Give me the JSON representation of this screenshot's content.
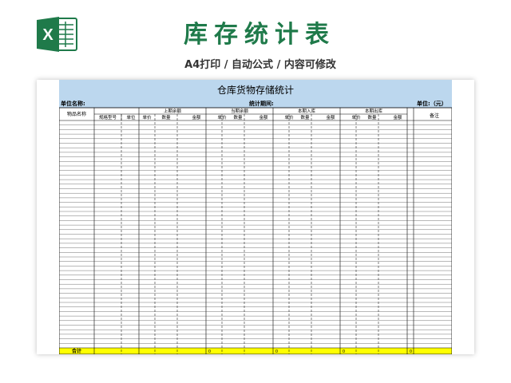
{
  "header": {
    "logo_letter": "X",
    "title": "库存统计表",
    "subtitle": "A4打印 / 自动公式 / 内容可修改"
  },
  "sheet": {
    "title": "仓库货物存储统计",
    "unit_name_label": "单位名称:",
    "period_label": "统计期间:",
    "unit_label": "单位:（元）",
    "col_item": "物品名称",
    "col_remark": "备注",
    "groups": [
      "上期余额",
      "当期余额",
      "本期入库",
      "本期出库"
    ],
    "sub_spec": "规格型号",
    "sub_unit": "单位",
    "sub_price": "单价",
    "sub_qty": "数量",
    "sub_amount": "金额",
    "total_label": "合计",
    "total_zero": "0"
  },
  "colors": {
    "brand_green": "#1f7a4a",
    "title_bar": "#bcd7ee",
    "total_row": "#ffff00"
  }
}
